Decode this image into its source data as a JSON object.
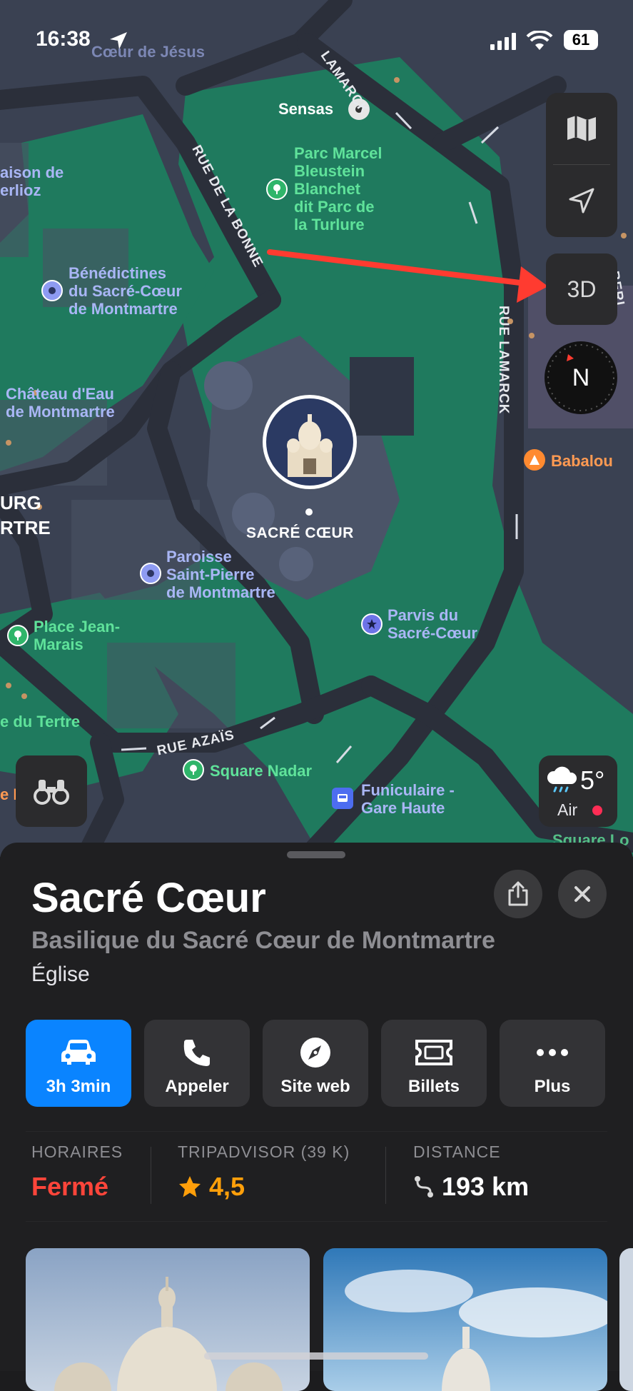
{
  "status_bar": {
    "time": "16:38",
    "battery": "61"
  },
  "map": {
    "places": {
      "coeur_jesus": "Cœur de Jésus",
      "sensas": "Sensas",
      "parc": [
        "Parc Marcel",
        "Bleustein",
        "Blanchet",
        "dit Parc de",
        "la Turlure"
      ],
      "maison": [
        "aison de",
        "erlioz"
      ],
      "benedictines": [
        "Bénédictines",
        "du Sacré-Cœur",
        "de Montmartre"
      ],
      "chateau": [
        "Château d'Eau",
        "de Montmartre"
      ],
      "sacre_coeur_pin": "SACRÉ CŒUR",
      "babalou": "Babalou",
      "paroisse": [
        "Paroisse",
        "Saint-Pierre",
        "de Montmartre"
      ],
      "parvis": [
        "Parvis du",
        "Sacré-Cœur"
      ],
      "place_jean": [
        "Place Jean-",
        "Marais"
      ],
      "tertre": "e du Tertre",
      "square_nadar": "Square Nadar",
      "funiculaire": [
        "Funiculaire -",
        "Gare Haute"
      ],
      "square_lo": "Square Lo",
      "urg": "URG",
      "rtre": "RTRE",
      "ep": "e P"
    },
    "streets": {
      "lamarck_top": "LAMARCK",
      "rue_bonne": "RUE DE LA BONNE",
      "rue_lamarck": "RUE LAMARCK",
      "rue_azais": "RUE AZAÏS",
      "beri": "BERI"
    },
    "controls": {
      "three_d": "3D",
      "compass": "N"
    },
    "weather": {
      "temp": "5°",
      "air": "Air"
    }
  },
  "sheet": {
    "title": "Sacré Cœur",
    "subtitle": "Basilique du Sacré Cœur de Montmartre",
    "category": "Église",
    "actions": [
      {
        "label": "3h 3min",
        "icon": "car-icon"
      },
      {
        "label": "Appeler",
        "icon": "phone-icon"
      },
      {
        "label": "Site web",
        "icon": "compass-icon"
      },
      {
        "label": "Billets",
        "icon": "ticket-icon"
      },
      {
        "label": "Plus",
        "icon": "ellipsis-icon"
      }
    ],
    "info": {
      "hours_label": "HORAIRES",
      "hours_value": "Fermé",
      "tripadvisor_label": "TRIPADVISOR (39 K)",
      "rating": "4,5",
      "distance_label": "DISTANCE",
      "distance_value": "193 km"
    }
  },
  "colors": {
    "map_bg": "#3a4152",
    "park": "#1f7a5e",
    "road": "#2b2f3a",
    "accent_blue": "#0a84ff",
    "closed_red": "#ff453a",
    "star_orange": "#ff9f0a",
    "annotation_arrow": "#ff3b30"
  }
}
